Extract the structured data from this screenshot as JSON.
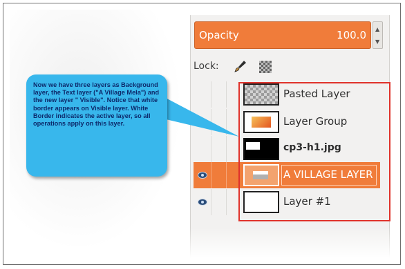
{
  "opacity": {
    "label": "Opacity",
    "value": "100.0"
  },
  "lock": {
    "label": "Lock:"
  },
  "icons": {
    "lock_pixels": "paintbrush-icon",
    "lock_alpha": "checkerboard-alpha-icon",
    "visibility": "eye-icon",
    "spin": "spin-arrows-icon"
  },
  "layers": [
    {
      "name": "Pasted Layer",
      "visible": false,
      "active": false,
      "bold": false
    },
    {
      "name": "Layer Group",
      "visible": false,
      "active": false,
      "bold": false
    },
    {
      "name": "cp3-h1.jpg",
      "visible": false,
      "active": false,
      "bold": true
    },
    {
      "name": "A VILLAGE LAYER",
      "visible": true,
      "active": true,
      "bold": false
    },
    {
      "name": "Layer #1",
      "visible": true,
      "active": false,
      "bold": false
    }
  ],
  "callout": {
    "text": "Now we have three layers as Background layer, the Text layer (\"A Village Mela\") and the new layer \" Visible\". Notice that white border appears on Visible layer. White Border indicates the active layer, so all operations apply on this layer."
  },
  "colors": {
    "accent": "#f07c3a",
    "callout": "#38b7ec",
    "highlight_box": "#e0322b"
  }
}
